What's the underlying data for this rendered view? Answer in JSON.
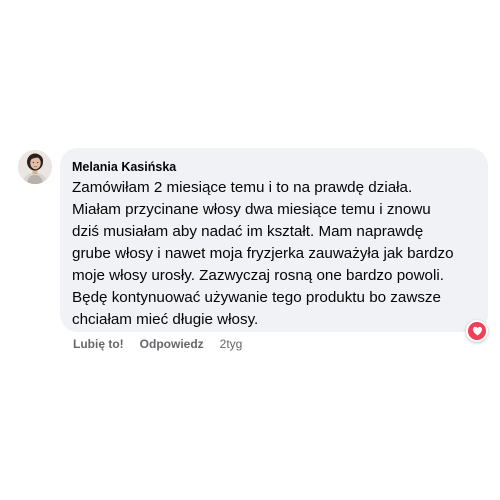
{
  "comment": {
    "author": "Melania Kasińska",
    "text_lines": [
      "Zamówiłam 2 miesiące temu i to na prawdę działa.",
      "Miałam przycinane włosy dwa miesiące temu i znowu",
      "dziś musiałam aby nadać im kształt. Mam naprawdę",
      "grube włosy i nawet moja fryzjerka zauważyła jak bardzo",
      "moje włosy urosły. Zazwyczaj rosną one bardzo powoli.",
      "Będę kontynuować używanie tego produktu bo zawsze",
      "chciałam mieć długie włosy."
    ],
    "reaction_icon": "heart-icon",
    "reaction_color": "#f33e58"
  },
  "actions": {
    "like_label": "Lubię to!",
    "reply_label": "Odpowiedz",
    "time_label": "2tyg"
  },
  "colors": {
    "bubble_bg": "#f0f2f5",
    "text": "#050505",
    "secondary_text": "#65676b"
  }
}
